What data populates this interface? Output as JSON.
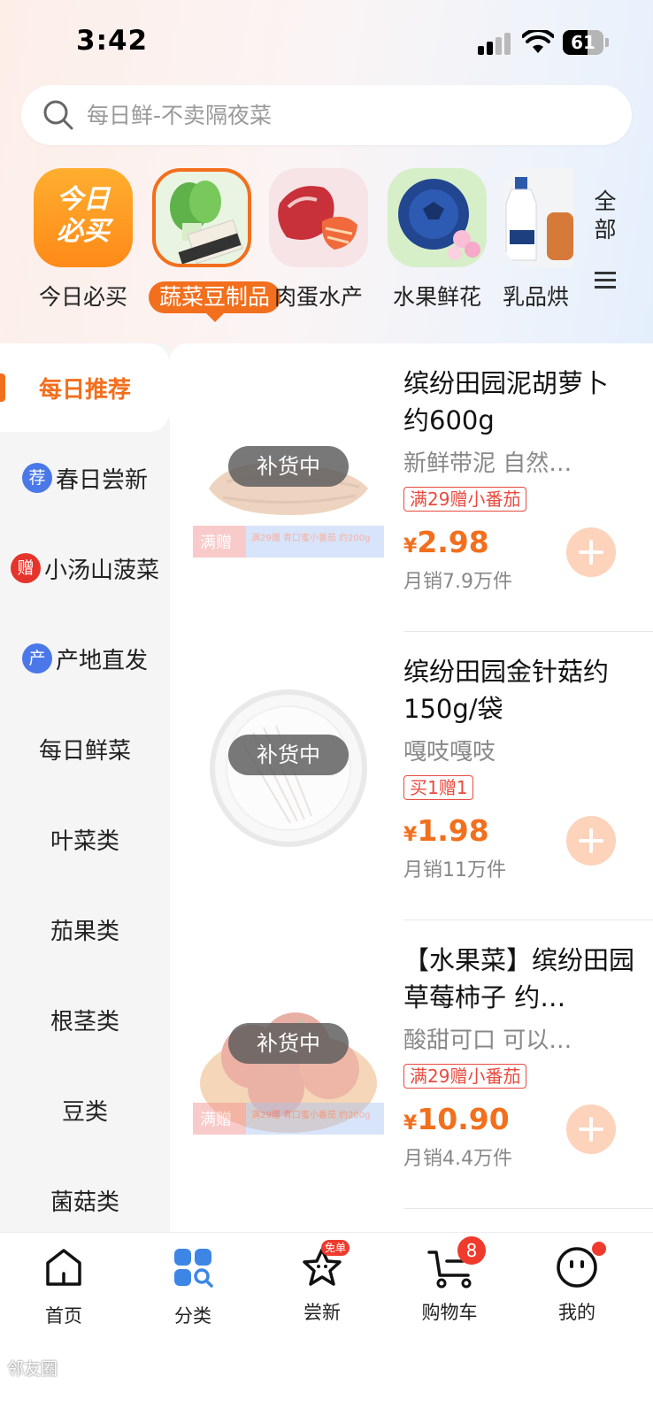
{
  "status_bar": {
    "time": "3:42",
    "battery": "61",
    "battery_level": 0.61
  },
  "search": {
    "placeholder": "每日鲜-不卖隔夜菜"
  },
  "categories": [
    {
      "label": "今日必买",
      "icon_text": [
        "今日",
        "必买"
      ],
      "active": false
    },
    {
      "label": "蔬菜豆制品",
      "active": true
    },
    {
      "label": "肉蛋水产",
      "active": false
    },
    {
      "label": "水果鲜花",
      "active": false
    },
    {
      "label": "乳品烘",
      "active": false
    }
  ],
  "all_button": {
    "label_line1": "全",
    "label_line2": "部"
  },
  "left_nav": [
    {
      "label": "每日推荐",
      "badge": "",
      "active": true
    },
    {
      "label": "春日尝新",
      "badge": "荐",
      "badge_color": "#4a78e8"
    },
    {
      "label": "小汤山菠菜",
      "badge": "赠",
      "badge_color": "#e5342c"
    },
    {
      "label": "产地直发",
      "badge": "产",
      "badge_color": "#4a78e8"
    },
    {
      "label": "每日鲜菜",
      "badge": ""
    },
    {
      "label": "叶菜类",
      "badge": ""
    },
    {
      "label": "茄果类",
      "badge": ""
    },
    {
      "label": "根茎类",
      "badge": ""
    },
    {
      "label": "豆类",
      "badge": ""
    },
    {
      "label": "菌菇类",
      "badge": ""
    }
  ],
  "products": [
    {
      "title": "缤纷田园泥胡萝卜 约600g",
      "subtitle": "新鲜带泥 自然…",
      "tag": "满29赠小番茄",
      "currency": "¥",
      "price": "2.98",
      "sales": "月销7.9万件",
      "status": "补货中",
      "has_banner": true
    },
    {
      "title": "缤纷田园金针菇约150g/袋",
      "subtitle": "嘎吱嘎吱",
      "tag": "买1赠1",
      "currency": "¥",
      "price": "1.98",
      "sales": "月销11万件",
      "status": "补货中",
      "has_banner": false
    },
    {
      "title": "【水果菜】缤纷田园草莓柿子 约…",
      "subtitle": "酸甜可口 可以…",
      "tag": "满29赠小番茄",
      "currency": "¥",
      "price": "10.90",
      "sales": "月销4.4万件",
      "status": "补货中",
      "has_banner": true
    }
  ],
  "promo_banner": {
    "left": "满赠",
    "right": "满29赠 青口蜜小番茄 约200g"
  },
  "tabs": [
    {
      "label": "首页",
      "icon": "home-icon",
      "active": false
    },
    {
      "label": "分类",
      "icon": "category-icon",
      "active": true
    },
    {
      "label": "尝新",
      "icon": "star-face-icon",
      "badge": "免单"
    },
    {
      "label": "购物车",
      "icon": "cart-icon",
      "badge": "8"
    },
    {
      "label": "我的",
      "icon": "smiley-icon",
      "dot": true
    }
  ],
  "watermark": "邻友圈",
  "colors": {
    "accent": "#f26f1d",
    "tab_active": "#2f7de1",
    "badge_red": "#ef3b2d"
  }
}
